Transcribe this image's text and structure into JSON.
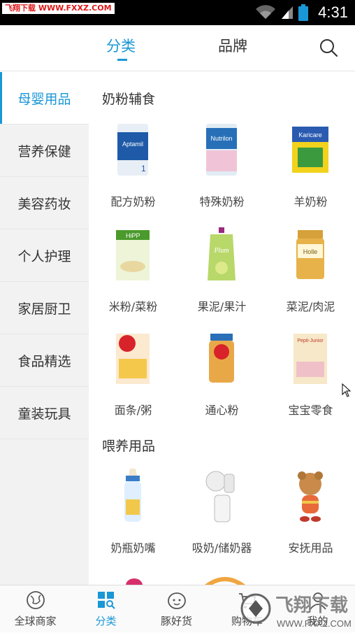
{
  "status_bar": {
    "watermark": "飞翔下载 WWW.FXXZ.COM",
    "time": "4:31"
  },
  "top_tabs": [
    {
      "label": "分类",
      "active": true
    },
    {
      "label": "品牌",
      "active": false
    }
  ],
  "search_icon": "search-icon",
  "sidebar": {
    "items": [
      {
        "label": "母婴用品",
        "active": true
      },
      {
        "label": "营养保健",
        "active": false
      },
      {
        "label": "美容药妆",
        "active": false
      },
      {
        "label": "个人护理",
        "active": false
      },
      {
        "label": "家居厨卫",
        "active": false
      },
      {
        "label": "食品精选",
        "active": false
      },
      {
        "label": "童装玩具",
        "active": false
      }
    ]
  },
  "sections": [
    {
      "title": "奶粉辅食",
      "items": [
        {
          "label": "配方奶粉",
          "pic_text": "Aptamil"
        },
        {
          "label": "特殊奶粉",
          "pic_text": "Nutrilon"
        },
        {
          "label": "羊奶粉",
          "pic_text": "Karicare"
        },
        {
          "label": "米粉/菜粉",
          "pic_text": "HiPP"
        },
        {
          "label": "果泥/果汁",
          "pic_text": "Plum"
        },
        {
          "label": "菜泥/肉泥",
          "pic_text": "Holle"
        },
        {
          "label": "面条/粥",
          "pic_text": "Cow&Gate"
        },
        {
          "label": "通心粉",
          "pic_text": "Cow&Gate"
        },
        {
          "label": "宝宝零食",
          "pic_text": "Pepti-Junior"
        }
      ]
    },
    {
      "title": "喂养用品",
      "items": [
        {
          "label": "奶瓶奶嘴",
          "pic_text": ""
        },
        {
          "label": "吸奶/储奶器",
          "pic_text": "AVENT"
        },
        {
          "label": "安抚用品",
          "pic_text": ""
        }
      ]
    }
  ],
  "bottom_nav": [
    {
      "label": "全球商家",
      "icon": "globe-icon",
      "active": false
    },
    {
      "label": "分类",
      "icon": "grid-search-icon",
      "active": true
    },
    {
      "label": "豚好货",
      "icon": "face-icon",
      "active": false
    },
    {
      "label": "购物车",
      "icon": "cart-icon",
      "active": false
    },
    {
      "label": "我的",
      "icon": "user-icon",
      "active": false
    }
  ],
  "watermark_bottom": "飞翔下载",
  "watermark_bottom_url": "WWW.FXXZ.COM",
  "colors": {
    "accent": "#1a97d6",
    "watermark_red": "#e01818"
  }
}
